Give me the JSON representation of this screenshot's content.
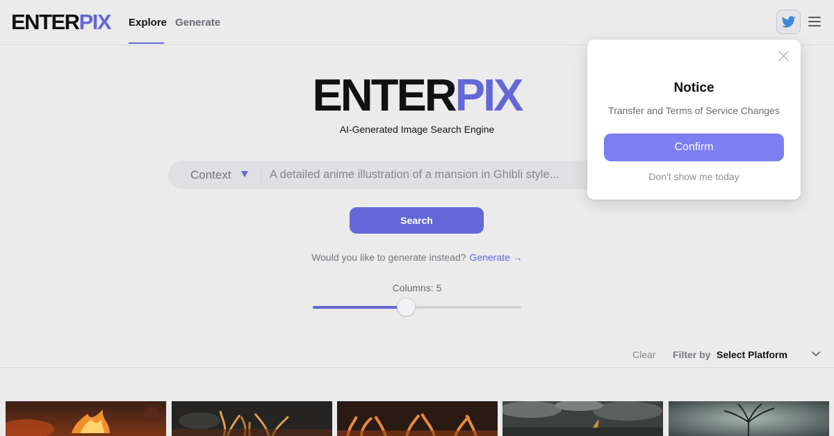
{
  "header": {
    "logo_part1": "ENTER",
    "logo_part2": "PIX",
    "tabs": [
      {
        "label": "Explore",
        "active": true
      },
      {
        "label": "Generate",
        "active": false
      }
    ],
    "social_icon": "twitter-icon",
    "menu_icon": "hamburger-icon"
  },
  "hero": {
    "logo_part1": "ENTER",
    "logo_part2": "PIX",
    "tagline": "AI-Generated Image Search Engine"
  },
  "search": {
    "mode": "Context",
    "placeholder": "A detailed anime illustration of a mansion in Ghibli style...",
    "button": "Search"
  },
  "generate_prompt": {
    "text": "Would you like to generate instead?",
    "link": "Generate →"
  },
  "columns": {
    "label": "Columns: 5",
    "value": 5,
    "min": 1,
    "max": 10
  },
  "filter": {
    "clear": "Clear",
    "label": "Filter by",
    "platform": "Select Platform"
  },
  "modal": {
    "title": "Notice",
    "subtitle": "Transfer and Terms of Service Changes",
    "confirm": "Confirm",
    "dismiss": "Don't show me today"
  },
  "colors": {
    "accent": "#6567d8",
    "modal_button": "#7b7ff0",
    "background": "#ebebec"
  },
  "thumbnails": [
    {
      "theme": "fire-dragon"
    },
    {
      "theme": "burning-tree"
    },
    {
      "theme": "fire-antlers"
    },
    {
      "theme": "storm-creature"
    },
    {
      "theme": "bare-tree"
    }
  ]
}
